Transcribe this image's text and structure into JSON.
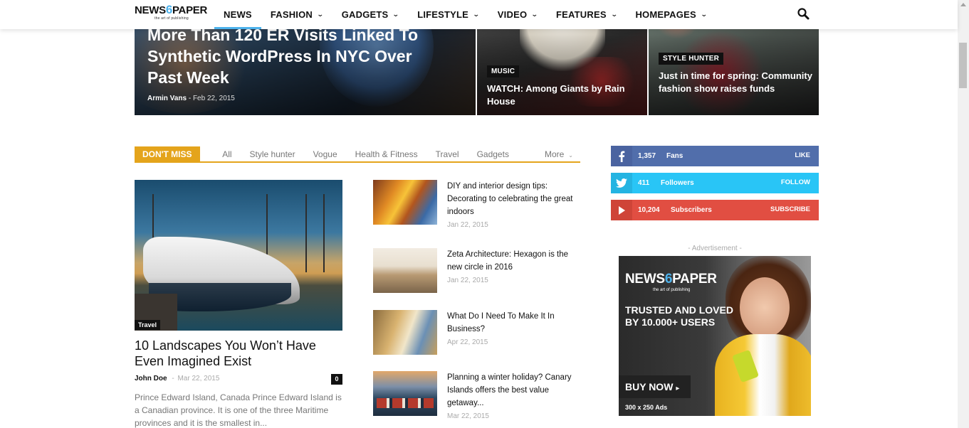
{
  "header": {
    "logo_main_a": "NEWS",
    "logo_six": "6",
    "logo_main_b": "PAPER",
    "logo_sub": "the art of publishing",
    "nav": [
      {
        "label": "NEWS",
        "dropdown": false,
        "active": true
      },
      {
        "label": "FASHION",
        "dropdown": true
      },
      {
        "label": "GADGETS",
        "dropdown": true
      },
      {
        "label": "LIFESTYLE",
        "dropdown": true
      },
      {
        "label": "VIDEO",
        "dropdown": true
      },
      {
        "label": "FEATURES",
        "dropdown": true
      },
      {
        "label": "HOMEPAGES",
        "dropdown": true
      }
    ],
    "dropdown_icon": "chevron-down-icon",
    "search_icon": "search-icon",
    "accent_color": "#4db2ec"
  },
  "hero": {
    "main": {
      "title": "More Than 120 ER Visits Linked To Synthetic WordPress In NYC Over Past Week",
      "author": "Armin Vans",
      "separator": "-",
      "date": "Feb 22, 2015"
    },
    "tiles": [
      {
        "category": "MUSIC",
        "title": "WATCH: Among Giants by Rain House"
      },
      {
        "category": "STYLE HUNTER",
        "title": "Just in time for spring: Community fashion show raises funds"
      }
    ]
  },
  "dont_miss": {
    "label": "DON'T MISS",
    "accent_color": "#e4a41c",
    "filters": [
      "All",
      "Style hunter",
      "Vogue",
      "Health & Fitness",
      "Travel",
      "Gadgets"
    ],
    "more_label": "More",
    "featured": {
      "category": "Travel",
      "title": "10 Landscapes You Won’t Have Even Imagined Exist",
      "author": "John Doe",
      "separator": "-",
      "date": "Mar 22, 2015",
      "comments": "0",
      "excerpt": "Prince Edward Island, Canada Prince Edward Island is a Canadian province. It is one of the three Maritime provinces and it is the smallest in..."
    },
    "list": [
      {
        "title": "DIY and interior design tips: Decorating to celebrating the great indoors",
        "date": "Jan 22, 2015"
      },
      {
        "title": "Zeta Architecture: Hexagon is the new circle in 2016",
        "date": "Jan 22, 2015"
      },
      {
        "title": "What Do I Need To Make It In Business?",
        "date": "Apr 22, 2015"
      },
      {
        "title": "Planning a winter holiday? Canary Islands offers the best value getaway...",
        "date": "Mar 22, 2015"
      }
    ]
  },
  "social": [
    {
      "network": "facebook",
      "icon": "facebook-icon",
      "count": "1,357",
      "label": "Fans",
      "action": "LIKE",
      "color": "#516eab"
    },
    {
      "network": "twitter",
      "icon": "twitter-icon",
      "count": "411",
      "label": "Followers",
      "action": "FOLLOW",
      "color": "#29c5f6"
    },
    {
      "network": "youtube",
      "icon": "youtube-icon",
      "count": "10,204",
      "label": "Subscribers",
      "action": "SUBSCRIBE",
      "color": "#e14e42"
    }
  ],
  "ad": {
    "label": "- Advertisement -",
    "logo_main_a": "NEWS",
    "logo_six": "6",
    "logo_main_b": "PAPER",
    "logo_sub": "the art of publishing",
    "tagline": "TRUSTED AND LOVED BY 10.000+ USERS",
    "cta": "BUY NOW",
    "cta_icon": "caret-right-icon",
    "size": "300 x 250 Ads"
  }
}
